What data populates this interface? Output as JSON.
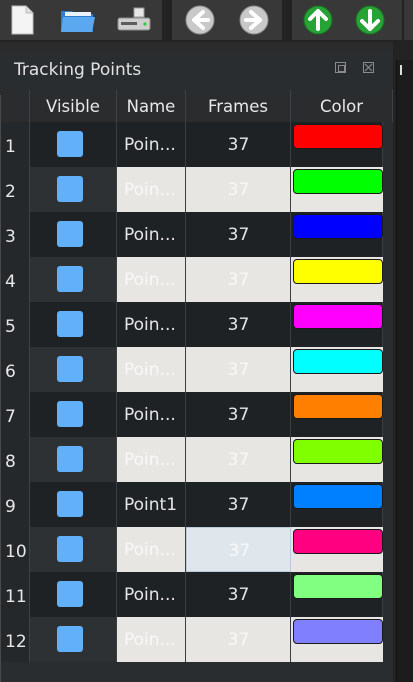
{
  "toolbar": {
    "buttons": [
      {
        "name": "new-file-icon"
      },
      {
        "name": "open-folder-icon"
      },
      {
        "name": "save-drive-icon"
      },
      {
        "name": "back-arrow-icon"
      },
      {
        "name": "forward-arrow-icon"
      },
      {
        "name": "up-arrow-icon"
      },
      {
        "name": "down-arrow-icon"
      }
    ]
  },
  "panel": {
    "title": "Tracking Points",
    "columns": [
      "Visible",
      "Name",
      "Frames",
      "Color"
    ],
    "rows": [
      {
        "num": "1",
        "name": "Poin...",
        "frames": "37",
        "color": "#ff0000",
        "visible": true
      },
      {
        "num": "2",
        "name": "Poin...",
        "frames": "37",
        "color": "#00ff00",
        "visible": true
      },
      {
        "num": "3",
        "name": "Poin...",
        "frames": "37",
        "color": "#0000ff",
        "visible": true
      },
      {
        "num": "4",
        "name": "Poin...",
        "frames": "37",
        "color": "#ffff00",
        "visible": true
      },
      {
        "num": "5",
        "name": "Poin...",
        "frames": "37",
        "color": "#ff00ff",
        "visible": true
      },
      {
        "num": "6",
        "name": "Poin...",
        "frames": "37",
        "color": "#00ffff",
        "visible": true
      },
      {
        "num": "7",
        "name": "Poin...",
        "frames": "37",
        "color": "#ff8000",
        "visible": true
      },
      {
        "num": "8",
        "name": "Poin...",
        "frames": "37",
        "color": "#80ff00",
        "visible": true
      },
      {
        "num": "9",
        "name": "Point1",
        "frames": "37",
        "color": "#0080ff",
        "visible": true
      },
      {
        "num": "10",
        "name": "Poin...",
        "frames": "37",
        "color": "#ff0080",
        "visible": true
      },
      {
        "num": "11",
        "name": "Poin...",
        "frames": "37",
        "color": "#80ff80",
        "visible": true
      },
      {
        "num": "12",
        "name": "Poin...",
        "frames": "37",
        "color": "#8080ff",
        "visible": true
      }
    ]
  }
}
